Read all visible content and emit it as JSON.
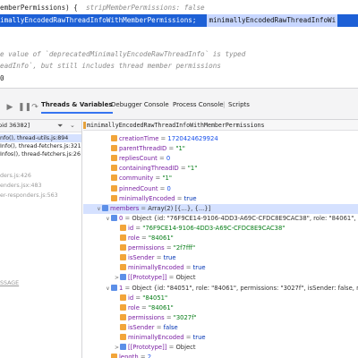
{
  "editor": {
    "line1_code": "emberPermissions) {",
    "line1_hint": "stripMemberPermissions: false",
    "line2_code": "imallyEncodedRawThreadInfoWithMemberPermissions",
    "line2_selected": "minimallyEncodedRawThreadInfoWi",
    "line3_comment": "e value of `deprecatedMinimallyEncodeRawThreadInfo` is typed",
    "line4_comment": "eadInfo`, but still includes thread member permissions",
    "line5_code": "0"
  },
  "debugger": {
    "tabs": [
      "Threads & Variables",
      "Debugger Console",
      "Process Console",
      "Scripts"
    ],
    "active_tab": "Threads & Variables",
    "tab_separator": "|"
  },
  "frames": {
    "thread_label": "pid 36382]",
    "items": [
      {
        "label": "nfo(), thread-utils.js:894",
        "style": "active"
      },
      {
        "label": "Info(), thread-fetchers.js:321",
        "style": "normal"
      },
      {
        "label": "Infos(), thread-fetchers.js:26",
        "style": "normal"
      },
      {
        "label": "ders.js:426",
        "style": "dim"
      },
      {
        "label": "enders.jsx:483",
        "style": "dim"
      },
      {
        "label": "er-responders.js:563",
        "style": "dim"
      },
      {
        "label": "SSAGE",
        "style": "underline"
      }
    ]
  },
  "variables": {
    "header": "minimallyEncodedRawThreadInfoWithMemberPermissions",
    "rows": [
      {
        "indent": 2,
        "chev": "",
        "type": "fld",
        "name": "creationTime",
        "eq": " = ",
        "value": "1720424629924",
        "vclass": "vnum"
      },
      {
        "indent": 2,
        "chev": "",
        "type": "fld",
        "name": "parentThreadID",
        "eq": " = ",
        "value": "\"1\"",
        "vclass": "vstr"
      },
      {
        "indent": 2,
        "chev": "",
        "type": "fld",
        "name": "repliesCount",
        "eq": " = ",
        "value": "0",
        "vclass": "vnum"
      },
      {
        "indent": 2,
        "chev": "",
        "type": "fld",
        "name": "containingThreadID",
        "eq": " = ",
        "value": "\"1\"",
        "vclass": "vstr"
      },
      {
        "indent": 2,
        "chev": "",
        "type": "fld",
        "name": "community",
        "eq": " = ",
        "value": "\"1\"",
        "vclass": "vstr"
      },
      {
        "indent": 2,
        "chev": "",
        "type": "fld",
        "name": "pinnedCount",
        "eq": " = ",
        "value": "0",
        "vclass": "vnum"
      },
      {
        "indent": 2,
        "chev": "",
        "type": "fld",
        "name": "minimallyEncoded",
        "eq": " = ",
        "value": "true",
        "vclass": "vkw"
      },
      {
        "indent": 1,
        "chev": "∨",
        "type": "obj",
        "name": "members",
        "eq": " = ",
        "value": "Array(2) [{...}, {...}]",
        "vclass": "vobj",
        "selected": true
      },
      {
        "indent": 2,
        "chev": "∨",
        "type": "obj",
        "name": "0",
        "eq": " = ",
        "value": "Object {id: \"76F9CE14-9106-4DD3-A69C-CFDC8E9CAC38\", role: \"84061\", permi",
        "vclass": "vobj"
      },
      {
        "indent": 3,
        "chev": "",
        "type": "fld",
        "name": "id",
        "eq": " = ",
        "value": "\"76F9CE14-9106-4DD3-A69C-CFDC8E9CAC38\"",
        "vclass": "vstr"
      },
      {
        "indent": 3,
        "chev": "",
        "type": "fld",
        "name": "role",
        "eq": " = ",
        "value": "\"84061\"",
        "vclass": "vstr"
      },
      {
        "indent": 3,
        "chev": "",
        "type": "fld",
        "name": "permissions",
        "eq": " = ",
        "value": "\"2f7fff\"",
        "vclass": "vstr"
      },
      {
        "indent": 3,
        "chev": "",
        "type": "fld",
        "name": "isSender",
        "eq": " = ",
        "value": "true",
        "vclass": "vkw"
      },
      {
        "indent": 3,
        "chev": "",
        "type": "fld",
        "name": "minimallyEncoded",
        "eq": " = ",
        "value": "true",
        "vclass": "vkw"
      },
      {
        "indent": 3,
        "chev": ">",
        "type": "obj",
        "name": "[[Prototype]]",
        "eq": " = ",
        "value": "Object",
        "vclass": "vobj"
      },
      {
        "indent": 2,
        "chev": "∨",
        "type": "obj",
        "name": "1",
        "eq": " = ",
        "value": "Object {id: \"84051\", role: \"84061\", permissions: \"3027f\", isSender: false, minimall",
        "vclass": "vobj"
      },
      {
        "indent": 3,
        "chev": "",
        "type": "fld",
        "name": "id",
        "eq": " = ",
        "value": "\"84051\"",
        "vclass": "vstr"
      },
      {
        "indent": 3,
        "chev": "",
        "type": "fld",
        "name": "role",
        "eq": " = ",
        "value": "\"84061\"",
        "vclass": "vstr"
      },
      {
        "indent": 3,
        "chev": "",
        "type": "fld",
        "name": "permissions",
        "eq": " = ",
        "value": "\"3027f\"",
        "vclass": "vstr"
      },
      {
        "indent": 3,
        "chev": "",
        "type": "fld",
        "name": "isSender",
        "eq": " = ",
        "value": "false",
        "vclass": "vkw"
      },
      {
        "indent": 3,
        "chev": "",
        "type": "fld",
        "name": "minimallyEncoded",
        "eq": " = ",
        "value": "true",
        "vclass": "vkw"
      },
      {
        "indent": 3,
        "chev": ">",
        "type": "obj",
        "name": "[[Prototype]]",
        "eq": " = ",
        "value": "Object",
        "vclass": "vobj"
      },
      {
        "indent": 2,
        "chev": "",
        "type": "fld",
        "name": "length",
        "eq": " = ",
        "value": "2",
        "vclass": "vnum"
      },
      {
        "indent": 2,
        "chev": ">",
        "type": "obj",
        "name": "[[Prototype]]",
        "eq": " = ",
        "value": "Array(0)",
        "vclass": "vobj"
      }
    ]
  },
  "colors": {
    "selection_blue": "#1d60d6",
    "row_selected": "#d5e1ff",
    "accent": "#3574f0"
  },
  "icons": [
    "filter-icon",
    "dropdown-icon",
    "field-icon",
    "object-icon",
    "chevron-down-icon",
    "chevron-right-icon"
  ]
}
